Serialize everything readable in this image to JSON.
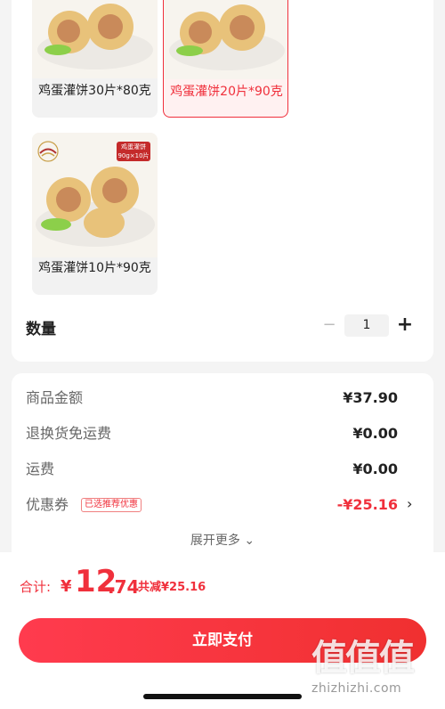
{
  "sku_options": [
    {
      "label": "鸡蛋灌饼30片*80克",
      "selected": false
    },
    {
      "label": "鸡蛋灌饼20片*90克",
      "selected": true
    },
    {
      "label": "鸡蛋灌饼10片*90克",
      "selected": false
    }
  ],
  "sku_badge": "鸡蛋灌饼 90g×10片",
  "quantity": {
    "label": "数量",
    "value": "1",
    "minus": "−",
    "plus": "+"
  },
  "fees": [
    {
      "label": "商品金额",
      "value": "¥37.90"
    },
    {
      "label": "退换货免运费",
      "value": "¥0.00"
    },
    {
      "label": "运费",
      "value": "¥0.00"
    },
    {
      "label": "优惠券",
      "tag": "已选推荐优惠",
      "value": "-¥25.16",
      "chevron": "›"
    }
  ],
  "expand_more": "展开更多 ⌄",
  "total": {
    "label": "合计:",
    "currency": "¥",
    "integer": "12",
    "decimal": ".74",
    "saved": "共减¥25.16"
  },
  "pay_button": "立即支付",
  "watermark": {
    "text": "值值值",
    "url": "zhizhizhi.com"
  },
  "colors": {
    "accent": "#f0303c",
    "selected_bg": "#fff1f1"
  }
}
